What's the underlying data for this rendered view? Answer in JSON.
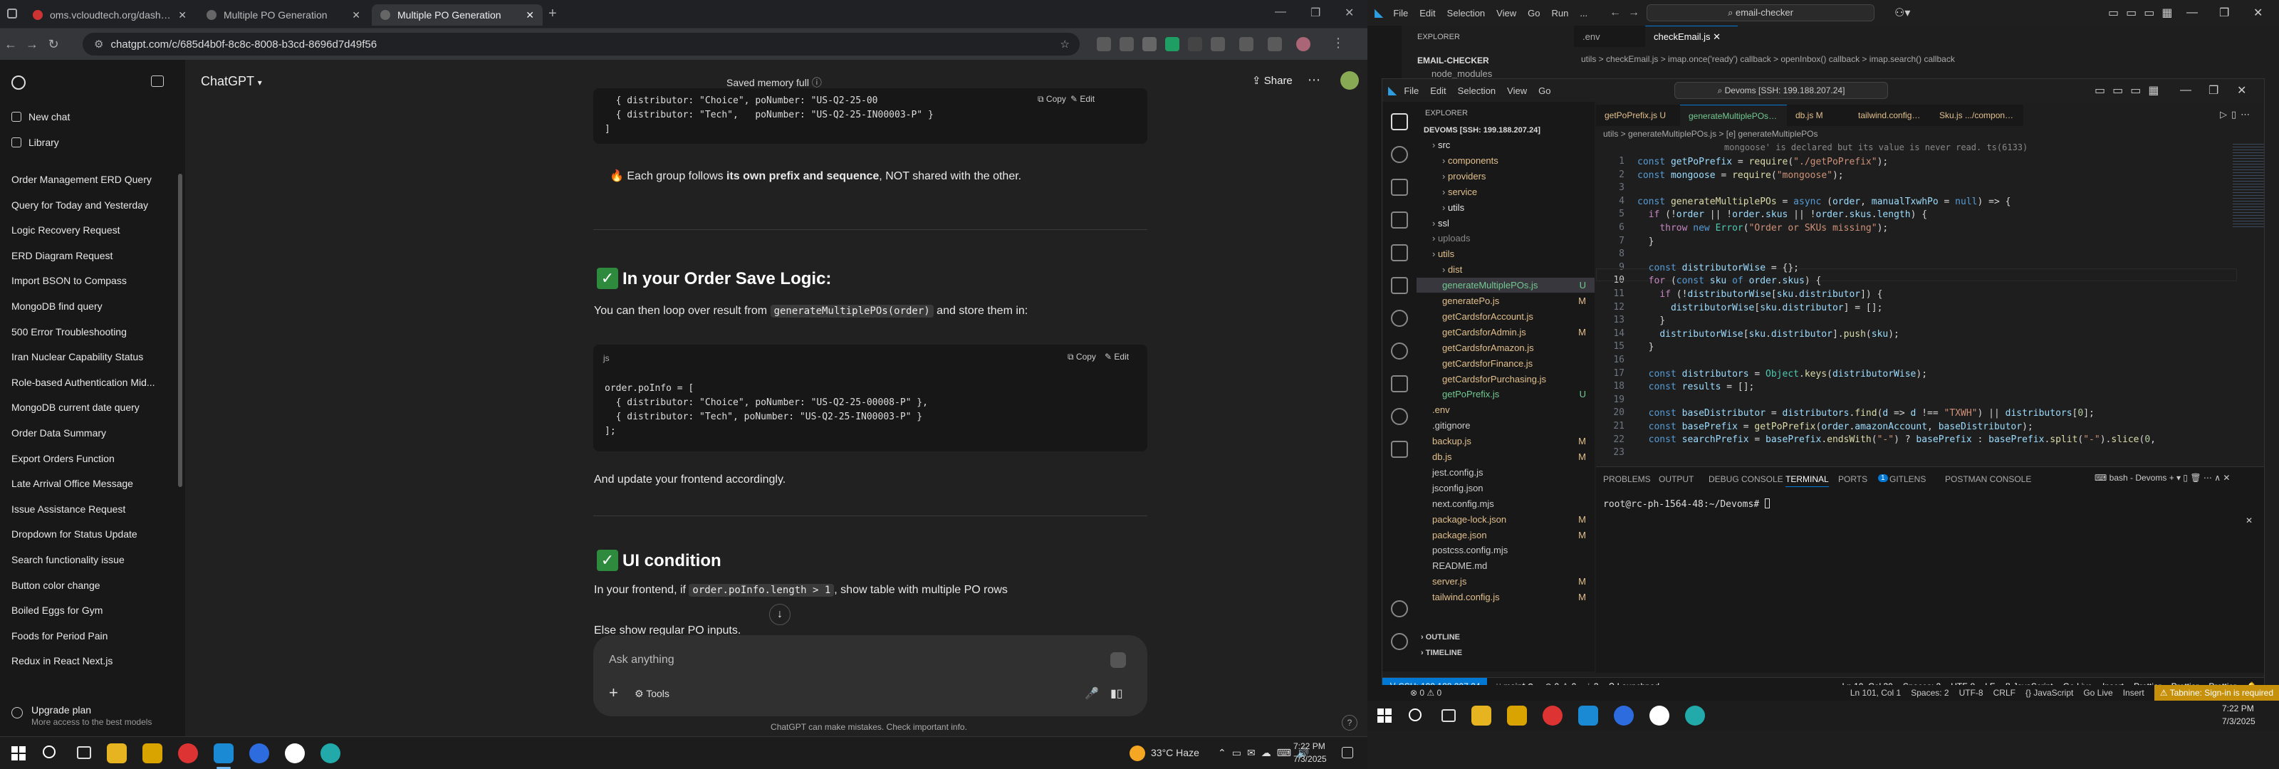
{
  "chrome": {
    "tabs": [
      {
        "label": "oms.vcloudtech.org/dashboard"
      },
      {
        "label": "Multiple PO Generation"
      },
      {
        "label": "Multiple PO Generation"
      }
    ],
    "url": "chatgpt.com/c/685d4b0f-8c8c-8008-b3cd-8696d7d49f56"
  },
  "chatgpt": {
    "model": "ChatGPT",
    "memory": "Saved memory full",
    "share": "Share",
    "new_chat": "New chat",
    "library": "Library",
    "history": [
      "Order Management ERD Query",
      "Query for Today and Yesterday",
      "Logic Recovery Request",
      "ERD Diagram Request",
      "Import BSON to Compass",
      "MongoDB find query",
      "500 Error Troubleshooting",
      "Iran Nuclear Capability Status",
      "Role-based Authentication Mid...",
      "MongoDB current date query",
      "Order Data Summary",
      "Export Orders Function",
      "Late Arrival Office Message",
      "Issue Assistance Request",
      "Dropdown for Status Update",
      "Search functionality issue",
      "Button color change",
      "Boiled Eggs for Gym",
      "Foods for Period Pain",
      "Redux in React Next.js"
    ],
    "upgrade_title": "Upgrade plan",
    "upgrade_sub": "More access to the best models",
    "code1": [
      "  { distributor: \"Choice\", poNumber: \"US-Q2-25-00",
      "  { distributor: \"Tech\",   poNumber: \"US-Q2-25-IN00003-P\" }",
      "]"
    ],
    "copy": "Copy",
    "edit": "Edit",
    "group_note_pre": "Each group follows ",
    "group_note_bold": "its own prefix and sequence",
    "group_note_post": ", NOT shared with the other.",
    "h_save": "In your Order Save Logic:",
    "p_loop_pre": "You can then loop over result from ",
    "p_loop_code": "generateMultiplePOs(order)",
    "p_loop_post": " and store them in:",
    "lang": "js",
    "code2": [
      "order.poInfo = [",
      "  { distributor: \"Choice\", poNumber: \"US-Q2-25-00008-P\" },",
      "  { distributor: \"Tech\", poNumber: \"US-Q2-25-IN00003-P\" }",
      "];"
    ],
    "p_update": "And update your frontend accordingly.",
    "h_ui": "UI condition",
    "p_ui_pre": "In your frontend, if ",
    "p_ui_code": "order.poInfo.length > 1",
    "p_ui_post": ", show table with multiple PO rows",
    "p_else": "Else show regular PO inputs.",
    "ask": "Ask anything",
    "tools": "Tools",
    "disclaimer": "ChatGPT can make mistakes. Check important info."
  },
  "taskbar_left": {
    "weather": "33°C  Haze",
    "time": "7:22 PM",
    "date": "7/3/2025"
  },
  "vscode": {
    "menus": [
      "File",
      "Edit",
      "Selection",
      "View",
      "Go",
      "Run",
      "..."
    ],
    "search": "email-checker",
    "outer_tabs": [
      ".env",
      "checkEmail.js"
    ],
    "outer_breadcrumb": "utils > checkEmail.js > imap.once('ready') callback > openInbox() callback > imap.search() callback",
    "explorer": "EXPLORER",
    "outer_project": "EMAIL-CHECKER",
    "outer_node": "node_modules",
    "inner_menus": [
      "File",
      "Edit",
      "Selection",
      "View",
      "Go"
    ],
    "inner_search": "Devoms [SSH: 199.188.207.24]",
    "inner_tabs": [
      "getPoPrefix.js  U",
      "generateMultiplePOs.js  U",
      "db.js  M",
      "tailwind.config.js  M",
      "Sku.js  .../component"
    ],
    "inner_breadcrumb": "utils > generateMultiplePOs.js > [e] generateMultiplePOs",
    "project": "DEVOMS [SSH: 199.188.207.24]",
    "tree": [
      {
        "n": "src",
        "d": 1,
        "t": "folder",
        "c": "#e8e8e8"
      },
      {
        "n": "components",
        "d": 2,
        "t": "folder",
        "c": "#e2c08d"
      },
      {
        "n": "providers",
        "d": 2,
        "t": "folder",
        "c": "#e2c08d"
      },
      {
        "n": "service",
        "d": 2,
        "t": "folder",
        "c": "#e2c08d"
      },
      {
        "n": "utils",
        "d": 2,
        "t": "folder",
        "c": "#e8e8e8"
      },
      {
        "n": "ssl",
        "d": 1,
        "t": "folder",
        "c": "#e8e8e8"
      },
      {
        "n": "uploads",
        "d": 1,
        "t": "folder",
        "c": "#888"
      },
      {
        "n": "utils",
        "d": 1,
        "t": "folder",
        "c": "#e2c08d"
      },
      {
        "n": "dist",
        "d": 2,
        "t": "folder",
        "c": "#e2c08d"
      },
      {
        "n": "generateMultiplePOs.js",
        "d": 2,
        "t": "file",
        "c": "#73c991",
        "m": "U",
        "sel": true
      },
      {
        "n": "generatePo.js",
        "d": 2,
        "t": "file",
        "c": "#e2c08d",
        "m": "M"
      },
      {
        "n": "getCardsforAccount.js",
        "d": 2,
        "t": "file",
        "c": "#e2c08d"
      },
      {
        "n": "getCardsforAdmin.js",
        "d": 2,
        "t": "file",
        "c": "#e2c08d",
        "m": "M"
      },
      {
        "n": "getCardsforAmazon.js",
        "d": 2,
        "t": "file",
        "c": "#e2c08d"
      },
      {
        "n": "getCardsforFinance.js",
        "d": 2,
        "t": "file",
        "c": "#e2c08d"
      },
      {
        "n": "getCardsforPurchasing.js",
        "d": 2,
        "t": "file",
        "c": "#e2c08d"
      },
      {
        "n": "getPoPrefix.js",
        "d": 2,
        "t": "file",
        "c": "#73c991",
        "m": "U"
      },
      {
        "n": ".env",
        "d": 1,
        "t": "file",
        "c": "#e2c08d"
      },
      {
        "n": ".gitignore",
        "d": 1,
        "t": "file",
        "c": "#ccc"
      },
      {
        "n": "backup.js",
        "d": 1,
        "t": "file",
        "c": "#e2c08d",
        "m": "M"
      },
      {
        "n": "db.js",
        "d": 1,
        "t": "file",
        "c": "#e2c08d",
        "m": "M"
      },
      {
        "n": "jest.config.js",
        "d": 1,
        "t": "file",
        "c": "#ccc"
      },
      {
        "n": "jsconfig.json",
        "d": 1,
        "t": "file",
        "c": "#ccc"
      },
      {
        "n": "next.config.mjs",
        "d": 1,
        "t": "file",
        "c": "#ccc"
      },
      {
        "n": "package-lock.json",
        "d": 1,
        "t": "file",
        "c": "#e2c08d",
        "m": "M"
      },
      {
        "n": "package.json",
        "d": 1,
        "t": "file",
        "c": "#e2c08d",
        "m": "M"
      },
      {
        "n": "postcss.config.mjs",
        "d": 1,
        "t": "file",
        "c": "#ccc"
      },
      {
        "n": "README.md",
        "d": 1,
        "t": "file",
        "c": "#ccc"
      },
      {
        "n": "server.js",
        "d": 1,
        "t": "file",
        "c": "#e2c08d",
        "m": "M"
      },
      {
        "n": "tailwind.config.js",
        "d": 1,
        "t": "file",
        "c": "#e2c08d",
        "m": "M"
      }
    ],
    "outline": "OUTLINE",
    "timeline": "TIMELINE",
    "hint": "mongoose' is declared but its value is never read. ts(6133)",
    "lines": [
      "1",
      "2",
      "3",
      "4",
      "5",
      "6",
      "7",
      "8",
      "9",
      "10",
      "11",
      "12",
      "13",
      "14",
      "15",
      "16",
      "17",
      "18",
      "19",
      "20",
      "21",
      "22",
      "23"
    ],
    "panel_tabs": [
      "PROBLEMS",
      "OUTPUT",
      "DEBUG CONSOLE",
      "TERMINAL",
      "PORTS",
      "GITLENS",
      "POSTMAN CONSOLE"
    ],
    "ports_count": "1",
    "terminal_shell": "bash - Devoms",
    "prompt": "root@rc-ph-1564-48:~/Devoms# ",
    "status_remote": "SSH: 199.188.207.24",
    "status_branch": "main*",
    "status_items": [
      "Launchpad",
      "Ln 10, Col 30",
      "Spaces: 2",
      "UTF-8",
      "LF",
      "{} JavaScript",
      "Go Live",
      "Insert",
      "Prettier",
      "Prettier",
      "Prettier"
    ],
    "status_errors": "0",
    "status_warnings": "0",
    "status_ports": "3",
    "outer_status_items": [
      "Ln 101, Col 1",
      "Spaces: 2",
      "UTF-8",
      "CRLF",
      "{} JavaScript",
      "Go Live",
      "Insert"
    ],
    "tabnine": "Tabnine: Sign-in is required",
    "time": "7:22 PM",
    "date": "7/3/2025"
  }
}
